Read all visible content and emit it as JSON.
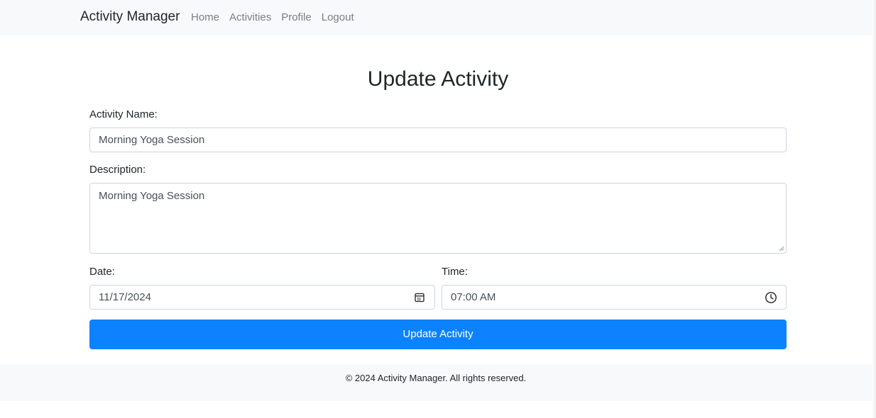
{
  "navbar": {
    "brand": "Activity Manager",
    "links": [
      "Home",
      "Activities",
      "Profile",
      "Logout"
    ]
  },
  "page_title": "Update Activity",
  "form": {
    "name_label": "Activity Name:",
    "name_value": "Morning Yoga Session",
    "description_label": "Description:",
    "description_value": "Morning Yoga Session",
    "date_label": "Date:",
    "date_value": "11/17/2024",
    "date_icon": "calendar-icon",
    "time_label": "Time:",
    "time_value": "07:00 AM",
    "time_icon": "clock-icon",
    "submit_label": "Update Activity"
  },
  "footer": {
    "text": "© 2024 Activity Manager. All rights reserved."
  },
  "colors": {
    "primary": "#0d82ff",
    "navbar_bg": "#f8f9fa",
    "nav_link": "#7a7f85",
    "border": "#ced4da"
  }
}
